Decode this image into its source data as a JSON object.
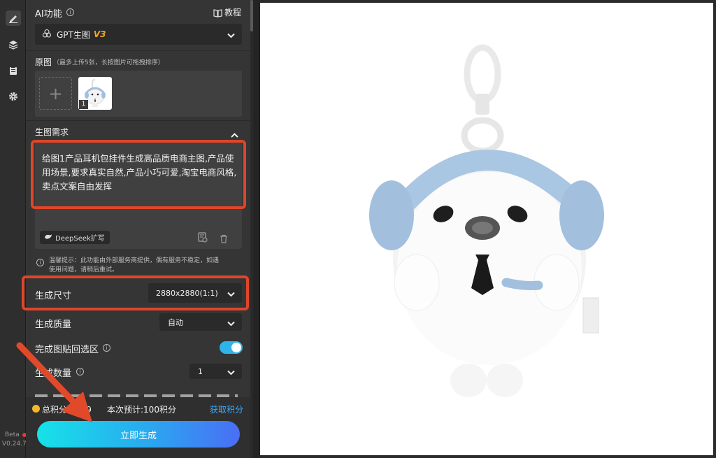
{
  "rail": {
    "beta": "Beta",
    "version": "V0.24.7"
  },
  "ai": {
    "title": "AI功能",
    "tutorial": "教程",
    "model": "GPT生图",
    "model_version": "V3"
  },
  "original": {
    "title": "原图",
    "hint": "（最多上传5张，长按图片可拖拽排序）",
    "thumb_index": "1"
  },
  "requirement": {
    "title": "生图需求",
    "prompt": "给图1产品耳机包挂件生成高品质电商主图,产品使用场景,要求真实自然,产品小巧可爱,淘宝电商风格,卖点文案自由发挥",
    "deepseek": "DeepSeek扩写"
  },
  "notice": {
    "text_line1": "温馨提示：此功能由外部服务商提供，偶有服务不稳定，如遇",
    "text_line2": "使用问题，请稍后重试。"
  },
  "size": {
    "label": "生成尺寸",
    "value": "2880x2880(1:1)"
  },
  "quality": {
    "label": "生成质量",
    "value": "自动"
  },
  "paste_back": {
    "label": "完成图贴回选区",
    "enabled": true
  },
  "count": {
    "label": "生成数量",
    "value": "1"
  },
  "footer": {
    "total_points": "总积分：339",
    "estimate": "本次预计:100积分",
    "get_points": "获取积分",
    "generate": "立即生成"
  },
  "colors": {
    "accent_red": "#e0452a",
    "toggle_blue": "#2fb4e9",
    "link_blue": "#3aa9ff",
    "model_version_orange": "#f5a623"
  }
}
